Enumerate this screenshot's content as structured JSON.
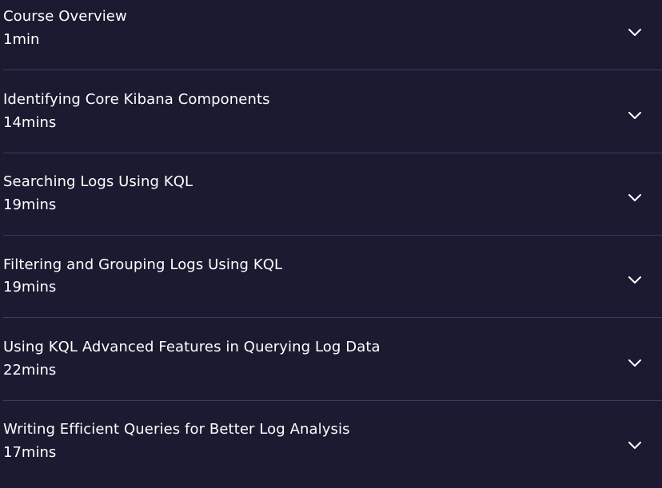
{
  "modules": [
    {
      "title": "Course Overview",
      "duration": "1min"
    },
    {
      "title": "Identifying Core Kibana Components",
      "duration": "14mins"
    },
    {
      "title": "Searching Logs Using KQL",
      "duration": "19mins"
    },
    {
      "title": "Filtering and Grouping Logs Using KQL",
      "duration": "19mins"
    },
    {
      "title": "Using KQL Advanced Features in Querying Log Data",
      "duration": "22mins"
    },
    {
      "title": "Writing Efficient Queries for Better Log Analysis",
      "duration": "17mins"
    }
  ],
  "icon": "chevron-down-icon",
  "colors": {
    "background": "#1b1a31",
    "text": "#ffffff",
    "divider": "#3b3a5a"
  }
}
